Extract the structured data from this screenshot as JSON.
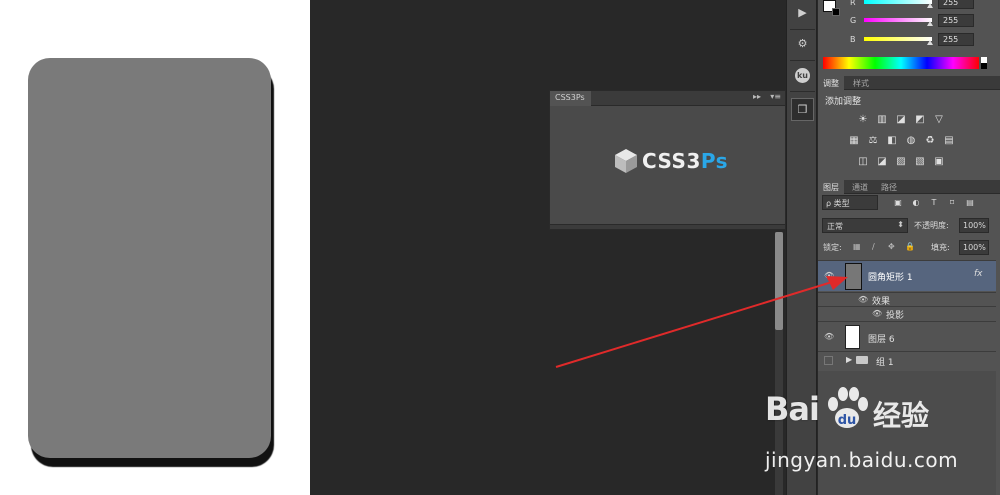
{
  "css3ps_panel": {
    "tab_label": "CSS3Ps",
    "logo_text_main": "CSS3",
    "logo_text_accent": "Ps",
    "collapse_glyph": "▸▸",
    "menu_glyph": "▾≡"
  },
  "dock": {
    "items": [
      {
        "icon": "play-icon",
        "glyph": "▶"
      },
      {
        "icon": "plugin-icon",
        "glyph": "⚙"
      },
      {
        "icon": "ku-icon",
        "glyph": "ku"
      },
      {
        "icon": "css3ps-icon",
        "glyph": "❒"
      }
    ]
  },
  "color_panel": {
    "rows": [
      {
        "label": "R",
        "value": "255"
      },
      {
        "label": "G",
        "value": "255"
      },
      {
        "label": "B",
        "value": "255"
      }
    ],
    "colors": {
      "fg": "#ffffff",
      "bg": "#000000"
    }
  },
  "adjustments_panel": {
    "tabs": [
      "调整",
      "样式"
    ],
    "title": "添加调整",
    "icons": [
      "☀",
      "▥",
      "◪",
      "◩",
      "▽",
      "▦",
      "⚖",
      "◧",
      "◍",
      "♻",
      "▤",
      "◫",
      "◪",
      "▨",
      "▧",
      "▣"
    ]
  },
  "layers_panel": {
    "tabs": [
      "图层",
      "通道",
      "路径"
    ],
    "filter_label": "ρ 类型",
    "filter_icons": [
      "▣",
      "◐",
      "T",
      "⌑",
      "▤"
    ],
    "blend_mode": "正常",
    "opacity_label": "不透明度:",
    "opacity_value": "100%",
    "lock_label": "锁定:",
    "lock_icons": [
      "▦",
      "∕",
      "✥",
      "🔒"
    ],
    "fill_label": "填充:",
    "fill_value": "100%",
    "layers": [
      {
        "name": "圆角矩形 1",
        "fx": "fx",
        "selected": true
      },
      {
        "name": "效果",
        "sub": true
      },
      {
        "name": "投影",
        "sub": true
      },
      {
        "name": "图层 6"
      },
      {
        "name": "组 1",
        "group": true
      }
    ]
  },
  "watermark": {
    "brand": "Bai",
    "brand_suffix": "经验",
    "url": "jingyan.baidu.com"
  }
}
